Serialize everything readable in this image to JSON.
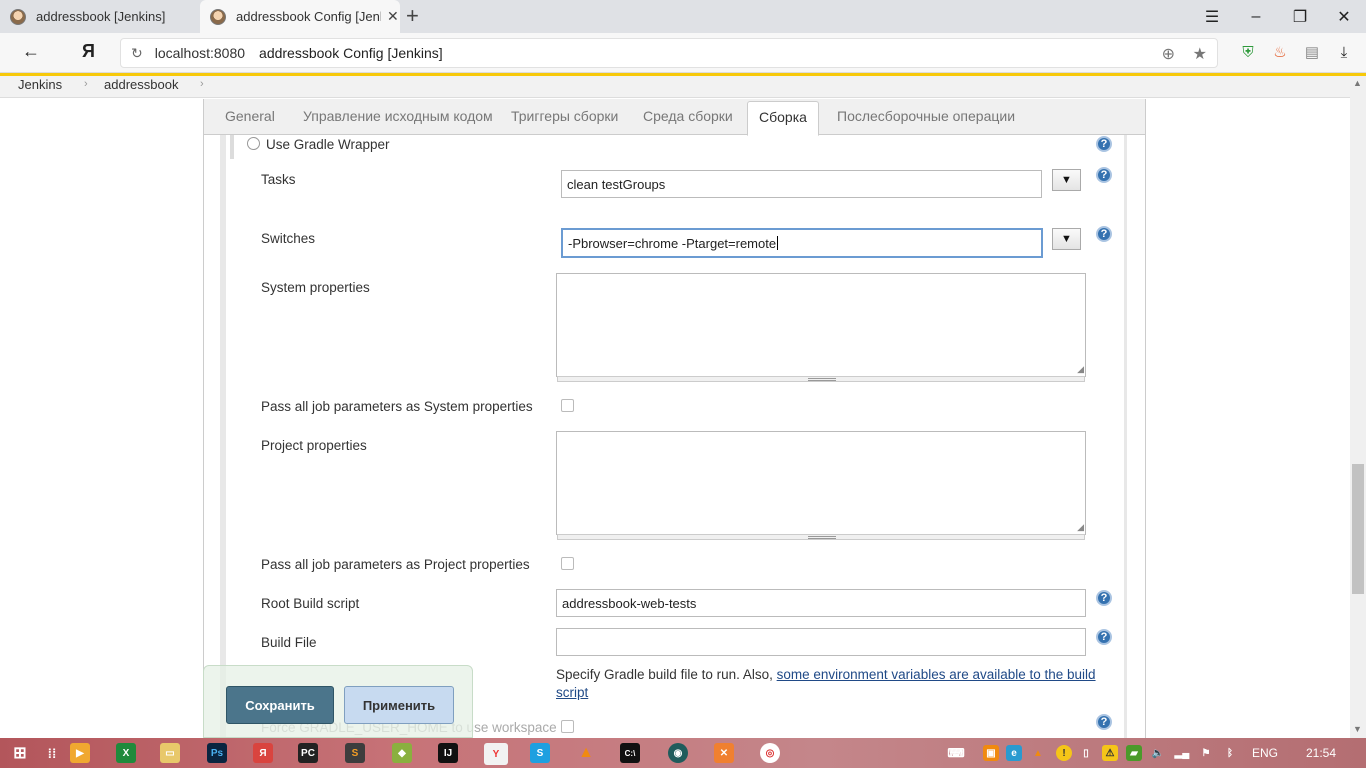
{
  "browser": {
    "tabs": [
      {
        "label": "addressbook [Jenkins]"
      },
      {
        "label": "addressbook Config [Jenk"
      }
    ],
    "address_host": "localhost:8080",
    "address_title": "addressbook Config [Jenkins]"
  },
  "breadcrumb": [
    "Jenkins",
    "addressbook"
  ],
  "config_tabs": [
    "General",
    "Управление исходным кодом",
    "Триггеры сборки",
    "Среда сборки",
    "Сборка",
    "Послесборочные операции"
  ],
  "active_tab": "Сборка",
  "form": {
    "use_gradle_wrapper": "Use Gradle Wrapper",
    "tasks_label": "Tasks",
    "tasks_value": "clean testGroups",
    "switches_label": "Switches",
    "switches_value": "-Pbrowser=chrome -Ptarget=remote",
    "system_properties_label": "System properties",
    "pass_system_label": "Pass all job parameters as System properties",
    "project_properties_label": "Project properties",
    "pass_project_label": "Pass all job parameters as Project properties",
    "root_build_label": "Root Build script",
    "root_build_value": "addressbook-web-tests",
    "build_file_label": "Build File",
    "build_file_value": "",
    "build_file_desc": "Specify Gradle build file to run. Also, ",
    "build_file_link": "some environment variables are available to the build script",
    "force_home_label": "Force GRADLE_USER_HOME to use workspace"
  },
  "buttons": {
    "save": "Сохранить",
    "apply": "Применить"
  },
  "taskbar": {
    "lang": "ENG",
    "time": "21:54"
  }
}
